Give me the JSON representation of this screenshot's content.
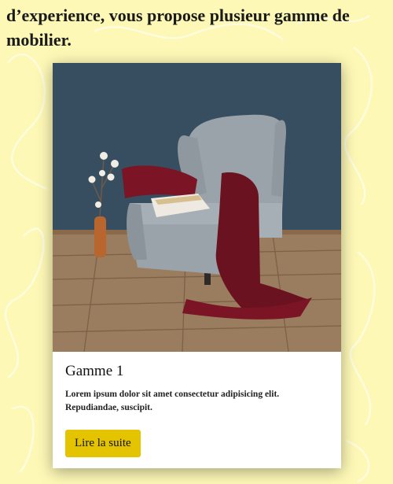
{
  "intro": {
    "text": "d’experience, vous propose plusieur gamme de mobilier."
  },
  "card": {
    "title": "Gamme 1",
    "description": "Lorem ipsum dolor sit amet consectetur adipisicing elit. Repudiandae, suscipit.",
    "button_label": "Lire la suite"
  },
  "colors": {
    "page_background": "#fdf8b6",
    "button_background": "#e4c400",
    "wall": "#3d5566",
    "armchair": "#9aa4ab",
    "throw": "#7a1624"
  }
}
